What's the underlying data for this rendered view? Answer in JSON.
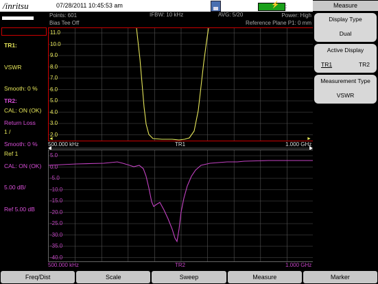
{
  "topbar": {
    "logo": "/inritsu",
    "datetime": "07/28/2011 10:45:53 am",
    "battery_label": ":"
  },
  "header": {
    "points": "Points: 601",
    "bias_tee": "Bias Tee Off",
    "ifbw": "IFBW: 10 kHz",
    "avg": "AVG: 5/20",
    "power": "Power: High",
    "reference_plane": "Reference Plane P1: 0 mm"
  },
  "tr1": {
    "title": "TR1:",
    "lines": [
      "VSWR",
      "Smooth: 0 %",
      "CAL: ON (OK)",
      "1 /",
      "Ref 1"
    ]
  },
  "tr2": {
    "title": "TR2:",
    "lines": [
      "Return Loss",
      "Smooth: 0 %",
      "CAL: ON (OK)",
      "5.00 dB/",
      "Ref 5.00 dB"
    ]
  },
  "plot1": {
    "start": "500.000 kHz",
    "name": "TR1",
    "stop": "1.000 GHz",
    "y_ticks": [
      "11.0",
      "10.0",
      "9.0",
      "8.0",
      "7.0",
      "6.0",
      "5.0",
      "4.0",
      "3.0",
      "2.0"
    ]
  },
  "plot2": {
    "start": "500.000 kHz",
    "name": "TR2",
    "stop": "1.000 GHz",
    "y_ticks": [
      "5.0",
      "0.0",
      "-5.0",
      "-10.0",
      "-15.0",
      "-20.0",
      "-25.0",
      "-30.0",
      "-35.0",
      "-40.0"
    ]
  },
  "right_panel": {
    "title": "Measure",
    "display_type": {
      "label": "Display Type",
      "value": "Dual"
    },
    "active_display": {
      "label": "Active Display",
      "opt1": "TR1",
      "opt2": "TR2"
    },
    "measurement_type": {
      "label": "Measurement Type",
      "value": "VSWR"
    }
  },
  "bottom_bar": [
    "Freq/Dist",
    "Scale",
    "Sweep",
    "Measure",
    "Marker"
  ],
  "colors": {
    "trace1": "#e8e85a",
    "trace2": "#c443c4",
    "frame1": "#cc0000"
  }
}
